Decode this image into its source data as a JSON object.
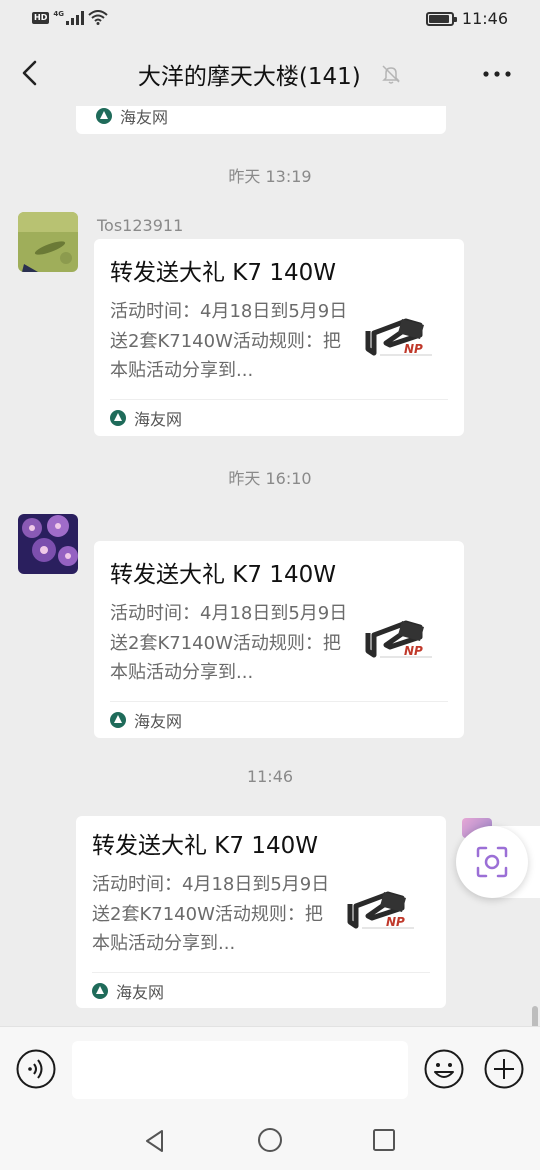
{
  "status_bar": {
    "hd": "HD",
    "network": "4G",
    "time": "11:46",
    "battery_level": 0.9
  },
  "header": {
    "title": "大洋的摩天大楼(141)",
    "back_icon": "chevron-left-icon",
    "mute_icon": "bell-off-icon",
    "more_icon": "more-dots-icon"
  },
  "chat": {
    "top_partial_card": {
      "source": "海友网"
    },
    "groups": [
      {
        "timestamp": "昨天 13:19",
        "sender": "Tos123911",
        "card": {
          "title": "转发送大礼 K7 140W",
          "description": "活动时间：4月18日到5月9日送2套K7140W活动规则：把本贴活动分享到...",
          "source": "海友网",
          "thumb_logo": "NP"
        }
      },
      {
        "timestamp": "昨天 16:10",
        "sender": "",
        "card": {
          "title": "转发送大礼 K7 140W",
          "description": "活动时间：4月18日到5月9日送2套K7140W活动规则：把本贴活动分享到...",
          "source": "海友网",
          "thumb_logo": "NP"
        }
      },
      {
        "timestamp": "11:46",
        "sender": "",
        "card": {
          "title": "转发送大礼 K7 140W",
          "description": "活动时间：4月18日到5月9日送2套K7140W活动规则：把本贴活动分享到...",
          "source": "海友网",
          "thumb_logo": "NP"
        }
      }
    ]
  },
  "input_bar": {
    "voice_icon": "voice-icon",
    "input_value": "",
    "emoji_icon": "emoji-icon",
    "plus_icon": "plus-icon"
  },
  "colors": {
    "background": "#ededed",
    "card": "#ffffff",
    "timestamp": "#8a8a8a",
    "scan_accent": "#9b6fd6"
  }
}
